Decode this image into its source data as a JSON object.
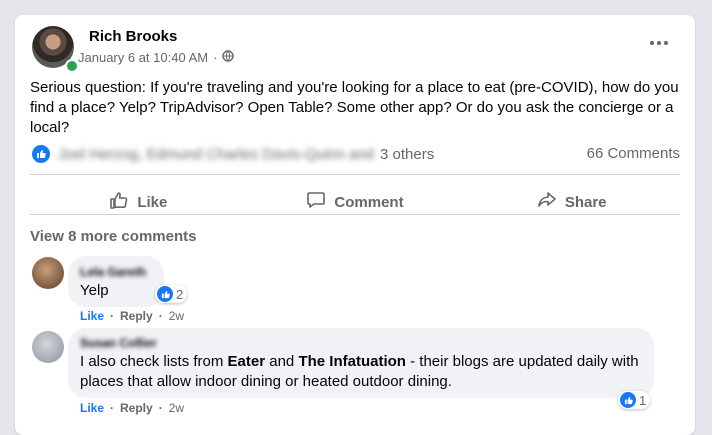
{
  "post": {
    "author": "Rich Brooks",
    "date": "January 6 at 10:40 AM",
    "separator": "·",
    "text": "Serious question: If you're traveling and you're looking for a place to eat (pre-COVID), how do you find a place? Yelp? TripAdvisor? Open Table? Some other app? Or do you ask the concierge or a local?",
    "likers_blurred": "Joel Herzog, Edmund Charles Davis-Quinn and",
    "others": "3 others",
    "comments_count": "66 Comments"
  },
  "actions": {
    "like": "Like",
    "comment": "Comment",
    "share": "Share"
  },
  "view_more": "View 8 more comments",
  "comments": [
    {
      "name_blurred": "Lela Gareth",
      "text": "Yelp",
      "reactions": "2",
      "like": "Like",
      "reply": "Reply",
      "sep": "·",
      "time": "2w"
    },
    {
      "name_blurred": "Susan Collier",
      "text_before": "I also check lists from ",
      "bold1": "Eater",
      "text_mid": " and ",
      "bold2": "The Infatuation",
      "text_after": " - their blogs are updated daily with places that allow indoor dining or heated outdoor dining.",
      "reactions": "1",
      "like": "Like",
      "reply": "Reply",
      "sep": "·",
      "time": "2w"
    }
  ],
  "colors": {
    "brand": "#1877f2",
    "muted": "#65676b",
    "online": "#31a24c"
  },
  "icons": [
    "globe-icon",
    "more-icon",
    "like-icon",
    "comment-icon",
    "share-icon"
  ]
}
